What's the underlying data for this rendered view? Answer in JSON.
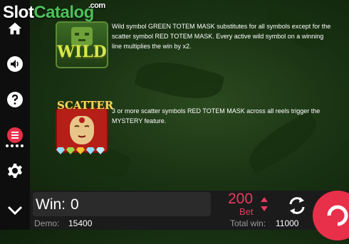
{
  "logo": {
    "part1": "Slot",
    "part2": "Catalog",
    "suffix": ".com"
  },
  "sidebar": {
    "items": [
      {
        "name": "home",
        "icon": "home-icon"
      },
      {
        "name": "sound",
        "icon": "speaker-icon"
      },
      {
        "name": "help",
        "icon": "question-icon"
      },
      {
        "name": "paytable",
        "icon": "paytable-icon"
      },
      {
        "name": "settings",
        "icon": "gear-icon"
      },
      {
        "name": "collapse",
        "icon": "chevron-down-icon"
      }
    ]
  },
  "paytable": {
    "wild": {
      "symbol_text": "WILD",
      "description": "Wild symbol GREEN TOTEM MASK substitutes for all symbols except for the scatter symbol RED TOTEM MASK. Every active wild symbol on a winning line multiplies the win by x2."
    },
    "scatter": {
      "symbol_text": "SCATTER",
      "description": "3 or more scatter symbols RED TOTEM MASK across all reels trigger the MYSTERY feature."
    },
    "gem_colors": [
      "#8fe0ff",
      "#9bd84a",
      "#f2c230",
      "#8fe0ff",
      "#b8f0ff"
    ]
  },
  "bottom_bar": {
    "win_label": "Win:",
    "win_value": "0",
    "bet_value": "200",
    "bet_label": "Bet",
    "demo_label": "Demo:",
    "demo_value": "15400",
    "total_label": "Total win:",
    "total_value": "11000"
  },
  "colors": {
    "accent": "#e73a5f",
    "spin_button": "#e8304a",
    "logo_green": "#4ec15a"
  }
}
